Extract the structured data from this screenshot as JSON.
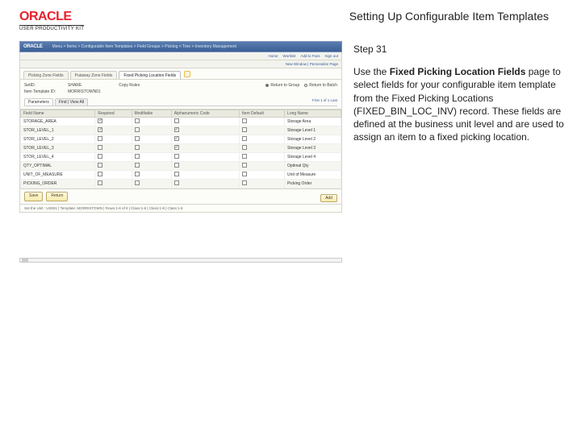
{
  "header": {
    "brand": "ORACLE",
    "brand_sub": "USER PRODUCTIVITY KIT",
    "page_title": "Setting Up Configurable Item Templates"
  },
  "instruction": {
    "step_label": "Step 31",
    "body_pre": "Use the ",
    "body_bold": "Fixed Picking Location Fields",
    "body_post": " page to select fields for your configurable item template from the Fixed Picking Locations (FIXED_BIN_LOC_INV) record. These fields are defined at the business unit level and are used to assign an item to a fixed picking location."
  },
  "app": {
    "brand": "ORACLE",
    "breadcrumb": "Menu > Items > Configurable Item Templates > Field Groups > Picking > Tree > Inventory Management",
    "toolbar_links": [
      "Home",
      "Worklist",
      "Add to Favs",
      "Sign out"
    ],
    "new_window": "New Window | Personalize Page",
    "tabs": [
      {
        "label": "Picking Zone Fields",
        "active": false
      },
      {
        "label": "Putaway Zone Fields",
        "active": false
      },
      {
        "label": "Fixed Picking Location Fields",
        "active": true
      }
    ],
    "form": {
      "set_label": "SetID:",
      "set_value": "SHARE",
      "copy_tmpl": "Copy Rules",
      "return_label": "Return to Group",
      "return2": "Return to Batch",
      "cfg_label": "Item Template ID:",
      "cfg_value": "MORRISTOWN01"
    },
    "subtabs": [
      {
        "label": "Parameters",
        "active": true
      },
      {
        "label": "Find | View All",
        "active": false
      }
    ],
    "find_text": "First 1 of 1 Last",
    "grid": {
      "headers": [
        "Field Name",
        "Required",
        "Modifiable",
        "Alphanumeric Code",
        "Item Default",
        "Long Name"
      ],
      "rows": [
        {
          "f": "STORAGE_AREA",
          "r": true,
          "m": false,
          "a": false,
          "d": false,
          "l": "Storage Area"
        },
        {
          "f": "STOR_LEVEL_1",
          "r": true,
          "m": false,
          "a": true,
          "d": false,
          "l": "Storage Level 1"
        },
        {
          "f": "STOR_LEVEL_2",
          "r": false,
          "m": false,
          "a": true,
          "d": false,
          "l": "Storage Level 2"
        },
        {
          "f": "STOR_LEVEL_3",
          "r": false,
          "m": false,
          "a": true,
          "d": false,
          "l": "Storage Level 3"
        },
        {
          "f": "STOR_LEVEL_4",
          "r": false,
          "m": false,
          "a": false,
          "d": false,
          "l": "Storage Level 4"
        },
        {
          "f": "QTY_OPTIMAL",
          "r": false,
          "m": false,
          "a": false,
          "d": false,
          "l": "Optimal Qty"
        },
        {
          "f": "UNIT_OF_MEASURE",
          "r": false,
          "m": false,
          "a": false,
          "d": false,
          "l": "Unit of Measure"
        },
        {
          "f": "PICKING_ORDER",
          "r": false,
          "m": false,
          "a": false,
          "d": false,
          "l": "Picking Order"
        }
      ]
    },
    "buttons": {
      "save": "Save",
      "return": "Return"
    },
    "add": "Add",
    "status": "Set the Unit : US001 | Template: MORRISTOWN | Rows:1-8 of 8 | Class:1-8 | Class:1-8 | Class:1-8"
  }
}
